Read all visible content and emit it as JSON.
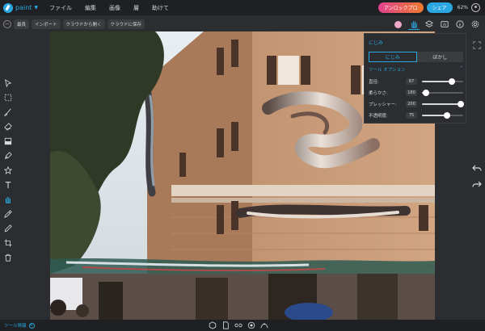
{
  "app": {
    "logo_text": "paint",
    "menu": [
      "ファイル",
      "編集",
      "画像",
      "層",
      "助けて"
    ],
    "unlock_label": "アンロックプロ",
    "share_label": "シェア",
    "zoom": "62%"
  },
  "toolbar": {
    "reset_label": "最良",
    "import_label": "インポート",
    "open_cloud_label": "クラウドから開く",
    "save_cloud_label": "クラウドに保存",
    "swatch_color": "#f0a8c8"
  },
  "tools": [
    "pointer-icon",
    "marquee-icon",
    "brush-icon",
    "eraser-icon",
    "fill-icon",
    "pen-icon",
    "star-icon",
    "text-icon",
    "smudge-icon",
    "dropper-icon",
    "pencil-icon",
    "crop-icon",
    "trash-icon"
  ],
  "panel": {
    "title": "にじみ",
    "mode_smudge": "にじみ",
    "mode_blur": "ぼかし",
    "options_heading": "ツール オプション",
    "options": [
      {
        "label": "直径:",
        "value": "67",
        "level": 0.72
      },
      {
        "label": "柔らかさ:",
        "value": "180",
        "level": 0.1
      },
      {
        "label": "プレッシャー:",
        "value": "200",
        "level": 0.95
      },
      {
        "label": "不透明度:",
        "value": "75",
        "level": 0.6
      }
    ]
  },
  "status": {
    "tool_info": "ツール情報"
  },
  "colors": {
    "accent": "#2aa7e0",
    "unlock_start": "#e0418f",
    "unlock_end": "#f07a2c"
  }
}
